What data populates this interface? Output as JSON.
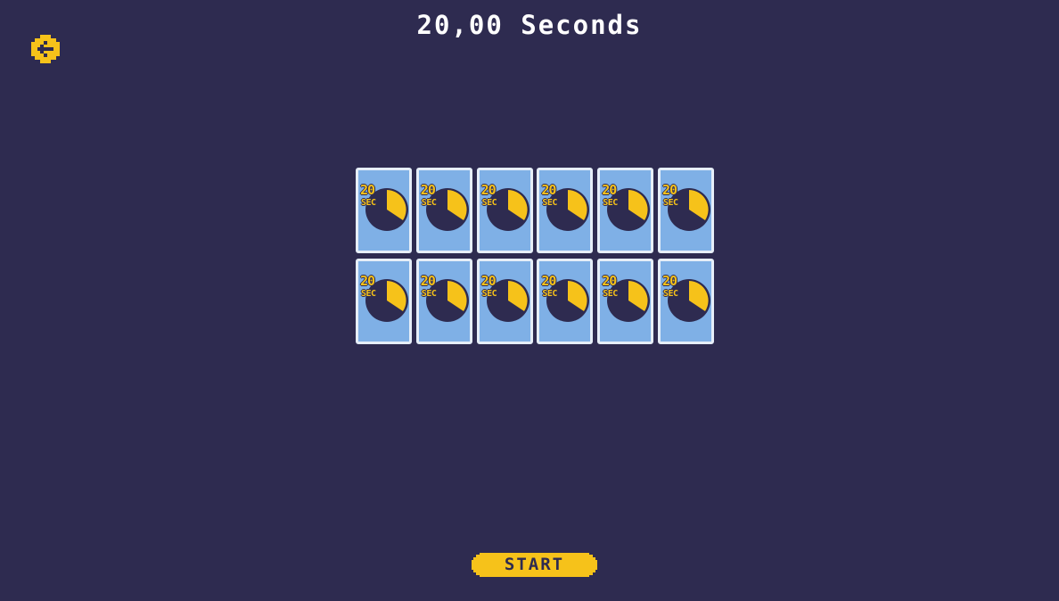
{
  "header": {
    "timer_label": "20,00 Seconds"
  },
  "back_button": {
    "icon": "arrow-left-circle-icon"
  },
  "cards": [
    {
      "number": "20",
      "unit": "SEC"
    },
    {
      "number": "20",
      "unit": "SEC"
    },
    {
      "number": "20",
      "unit": "SEC"
    },
    {
      "number": "20",
      "unit": "SEC"
    },
    {
      "number": "20",
      "unit": "SEC"
    },
    {
      "number": "20",
      "unit": "SEC"
    },
    {
      "number": "20",
      "unit": "SEC"
    },
    {
      "number": "20",
      "unit": "SEC"
    },
    {
      "number": "20",
      "unit": "SEC"
    },
    {
      "number": "20",
      "unit": "SEC"
    },
    {
      "number": "20",
      "unit": "SEC"
    },
    {
      "number": "20",
      "unit": "SEC"
    }
  ],
  "start_button": {
    "label": "START"
  },
  "colors": {
    "background": "#2e2b50",
    "card_face": "#7fb0e6",
    "card_border": "#e6eef8",
    "accent": "#f6c21a",
    "text": "#ffffff"
  }
}
